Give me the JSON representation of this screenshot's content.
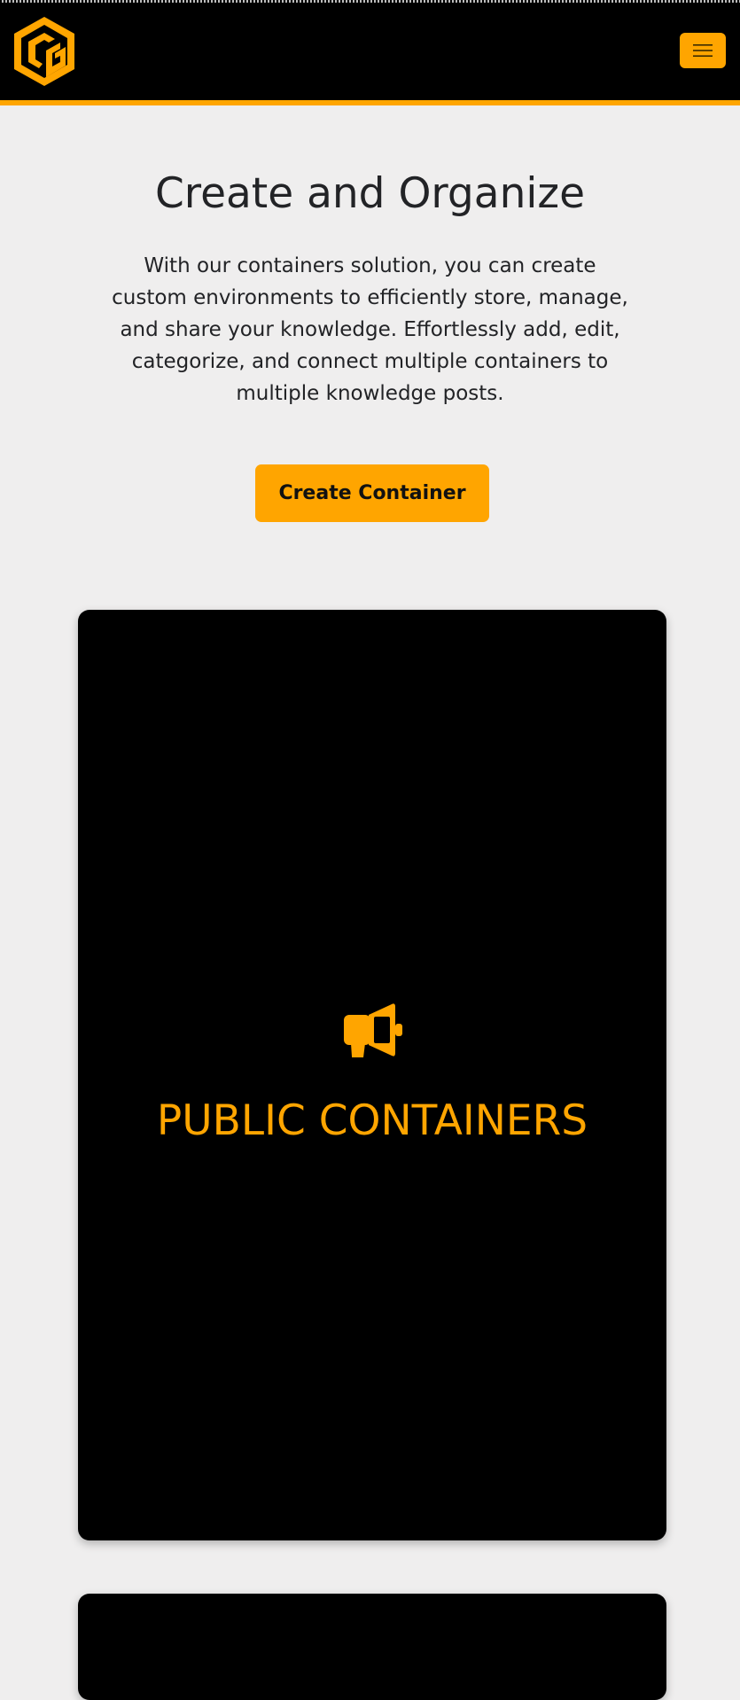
{
  "navbar": {
    "logo_icon": "cg-cube-logo-icon",
    "menu_icon": "hamburger-menu-icon"
  },
  "hero": {
    "title": "Create and Organize",
    "description": "With our containers solution, you can create custom environments to efficiently store, manage, and share your knowledge. Effortlessly add, edit, categorize, and connect multiple containers to multiple knowledge posts.",
    "button_label": "Create Container"
  },
  "cards": [
    {
      "icon": "megaphone-icon",
      "title": "PUBLIC CONTAINERS"
    }
  ],
  "colors": {
    "accent": "#ffa500",
    "navbar_background": "#000000",
    "page_background": "#efeeee",
    "text": "#222326",
    "card_background": "#000000"
  }
}
